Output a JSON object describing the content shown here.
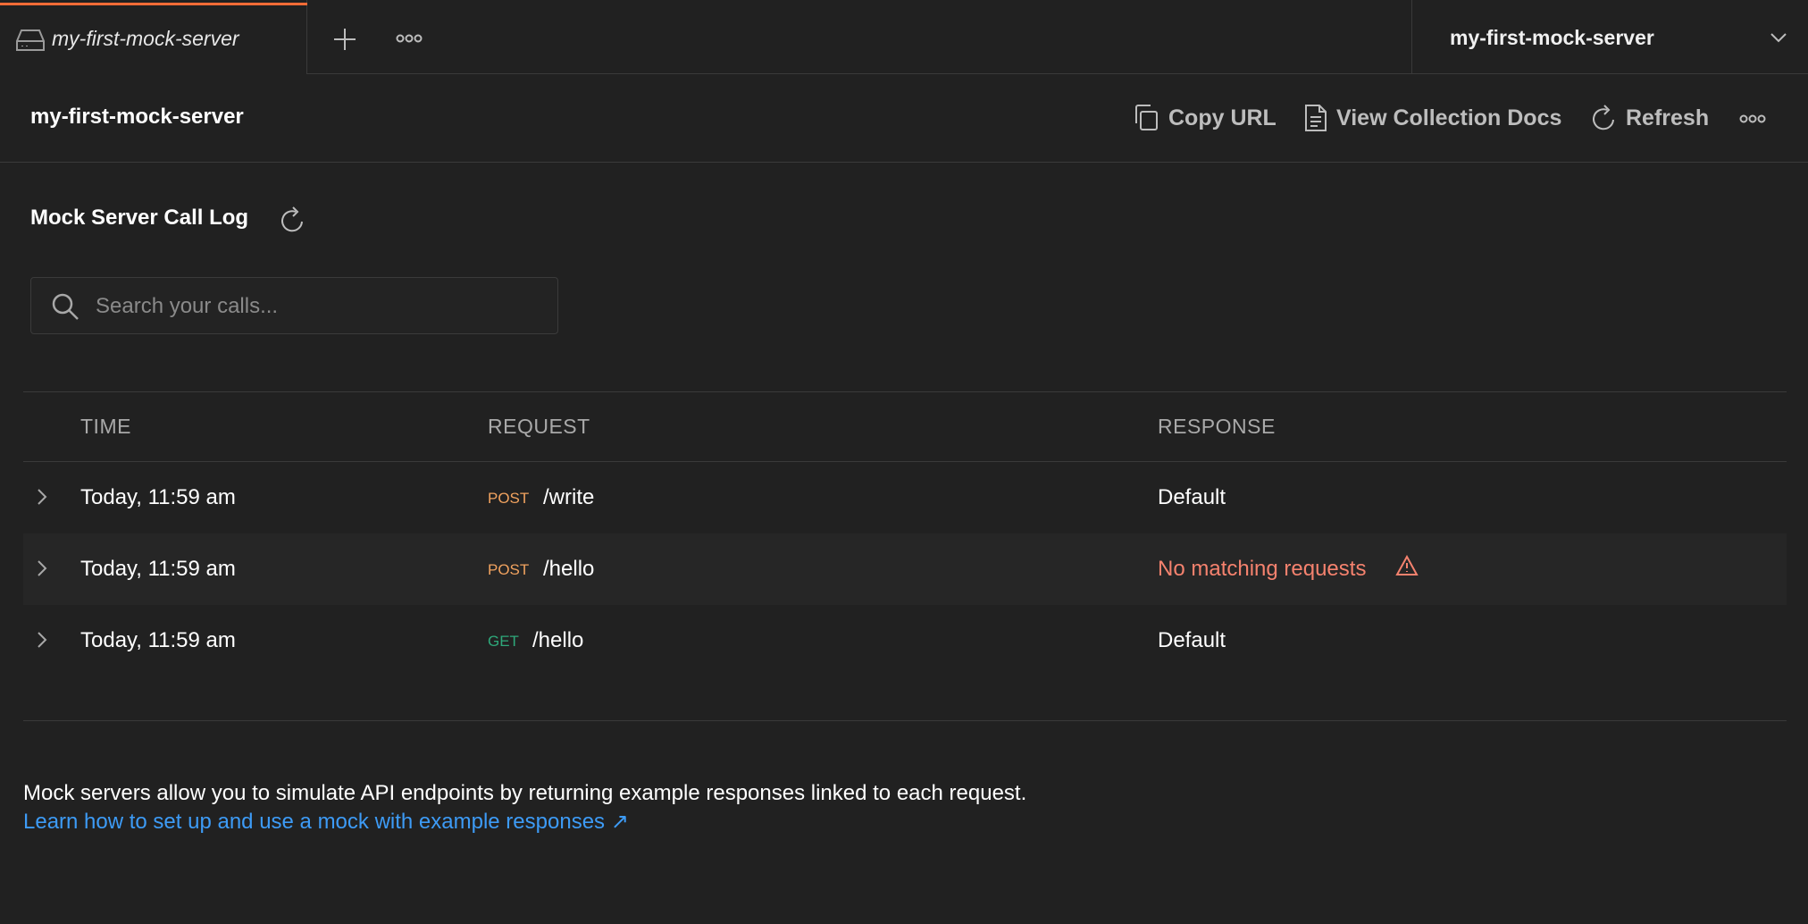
{
  "colors": {
    "accent": "#ff6c37",
    "background": "#212121",
    "post_method": "#f0a25f",
    "get_method": "#2ea87a",
    "warning": "#f5826e",
    "link": "#3d9bf6"
  },
  "tabs": {
    "active": {
      "title": "my-first-mock-server",
      "icon": "mock-server-icon"
    },
    "add_icon": "plus-icon",
    "more_icon": "more-icon"
  },
  "environment": {
    "selected": "my-first-mock-server",
    "icon": "chevron-down-icon"
  },
  "header": {
    "title": "my-first-mock-server",
    "copy_url_label": "Copy URL",
    "view_docs_label": "View Collection Docs",
    "refresh_label": "Refresh"
  },
  "call_log": {
    "title": "Mock Server Call Log",
    "search_placeholder": "Search your calls...",
    "columns": {
      "time": "TIME",
      "request": "REQUEST",
      "response": "RESPONSE"
    },
    "rows": [
      {
        "time": "Today, 11:59 am",
        "method": "POST",
        "path": "/write",
        "response": "Default",
        "warning": false
      },
      {
        "time": "Today, 11:59 am",
        "method": "POST",
        "path": "/hello",
        "response": "No matching requests",
        "warning": true
      },
      {
        "time": "Today, 11:59 am",
        "method": "GET",
        "path": "/hello",
        "response": "Default",
        "warning": false
      }
    ]
  },
  "footer": {
    "description": "Mock servers allow you to simulate API endpoints by returning example responses linked to each request.",
    "link_text": "Learn how to set up and use a mock with example responses ↗"
  }
}
